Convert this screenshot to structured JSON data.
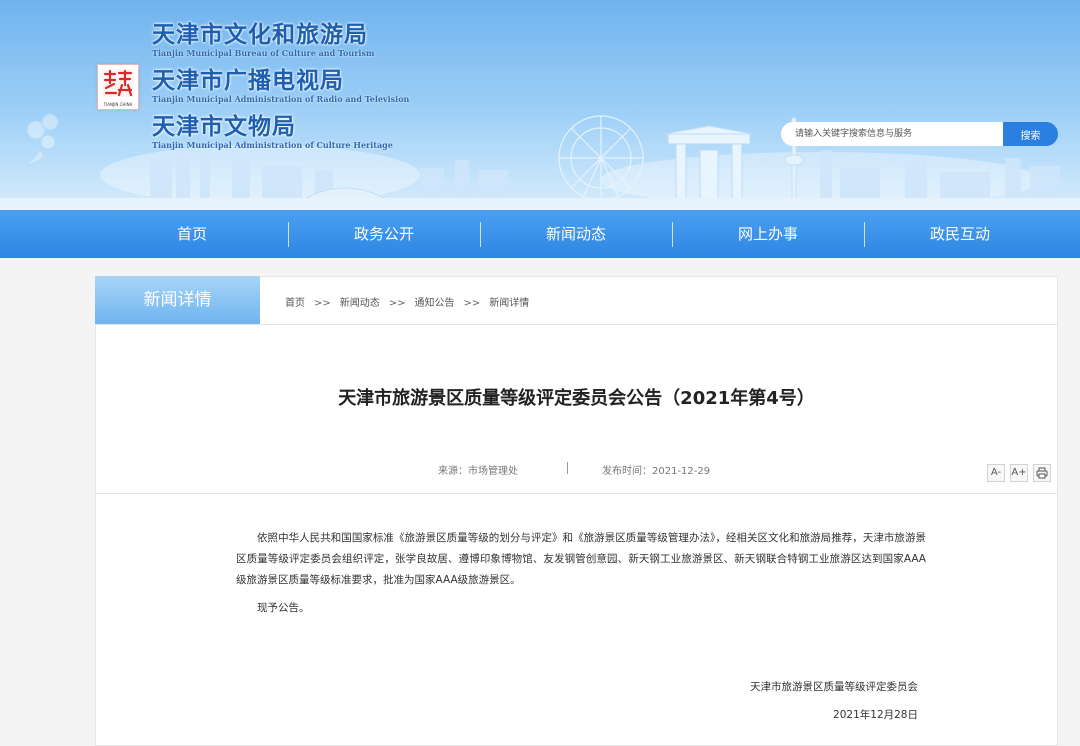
{
  "header": {
    "orgs": [
      {
        "cn": "天津市文化和旅游局",
        "en": "Tianjin Municipal Bureau of Culture and Tourism"
      },
      {
        "cn": "天津市广播电视局",
        "en": "Tianjin Municipal Administration of Radio and Television"
      },
      {
        "cn": "天津市文物局",
        "en": "Tianjin Municipal Administration of Culture Heritage"
      }
    ],
    "search_placeholder": "请输入关键字搜索信息与服务",
    "search_button": "搜索"
  },
  "nav": [
    "首页",
    "政务公开",
    "新闻动态",
    "网上办事",
    "政民互动"
  ],
  "section": {
    "tab_label": "新闻详情",
    "breadcrumb": [
      "首页",
      "新闻动态",
      "通知公告",
      "新闻详情"
    ],
    "breadcrumb_separator": ">>"
  },
  "article": {
    "title": "天津市旅游景区质量等级评定委员会公告（2021年第4号）",
    "source": "来源：市场管理处",
    "publish_time": "发布时间：2021-12-29",
    "tools": {
      "font_smaller": "A-",
      "font_larger": "A+",
      "print": "print-icon"
    },
    "paragraph1": "依照中华人民共和国国家标准《旅游景区质量等级的划分与评定》和《旅游景区质量等级管理办法》，经相关区文化和旅游局推荐，天津市旅游景区质量等级评定委员会组织评定，张学良故居、遵博印象博物馆、友发钢管创意园、新天钢工业旅游景区、新天钢联合特钢工业旅游区达到国家AAA级旅游景区质量等级标准要求，批准为国家AAA级旅游景区。",
    "paragraph2": "现予公告。",
    "signature": "天津市旅游景区质量等级评定委员会",
    "date": "2021年12月28日"
  },
  "colors": {
    "nav": "#3a8fe8",
    "tab": "#8cc6f3",
    "search_button": "#2a7fe0"
  }
}
